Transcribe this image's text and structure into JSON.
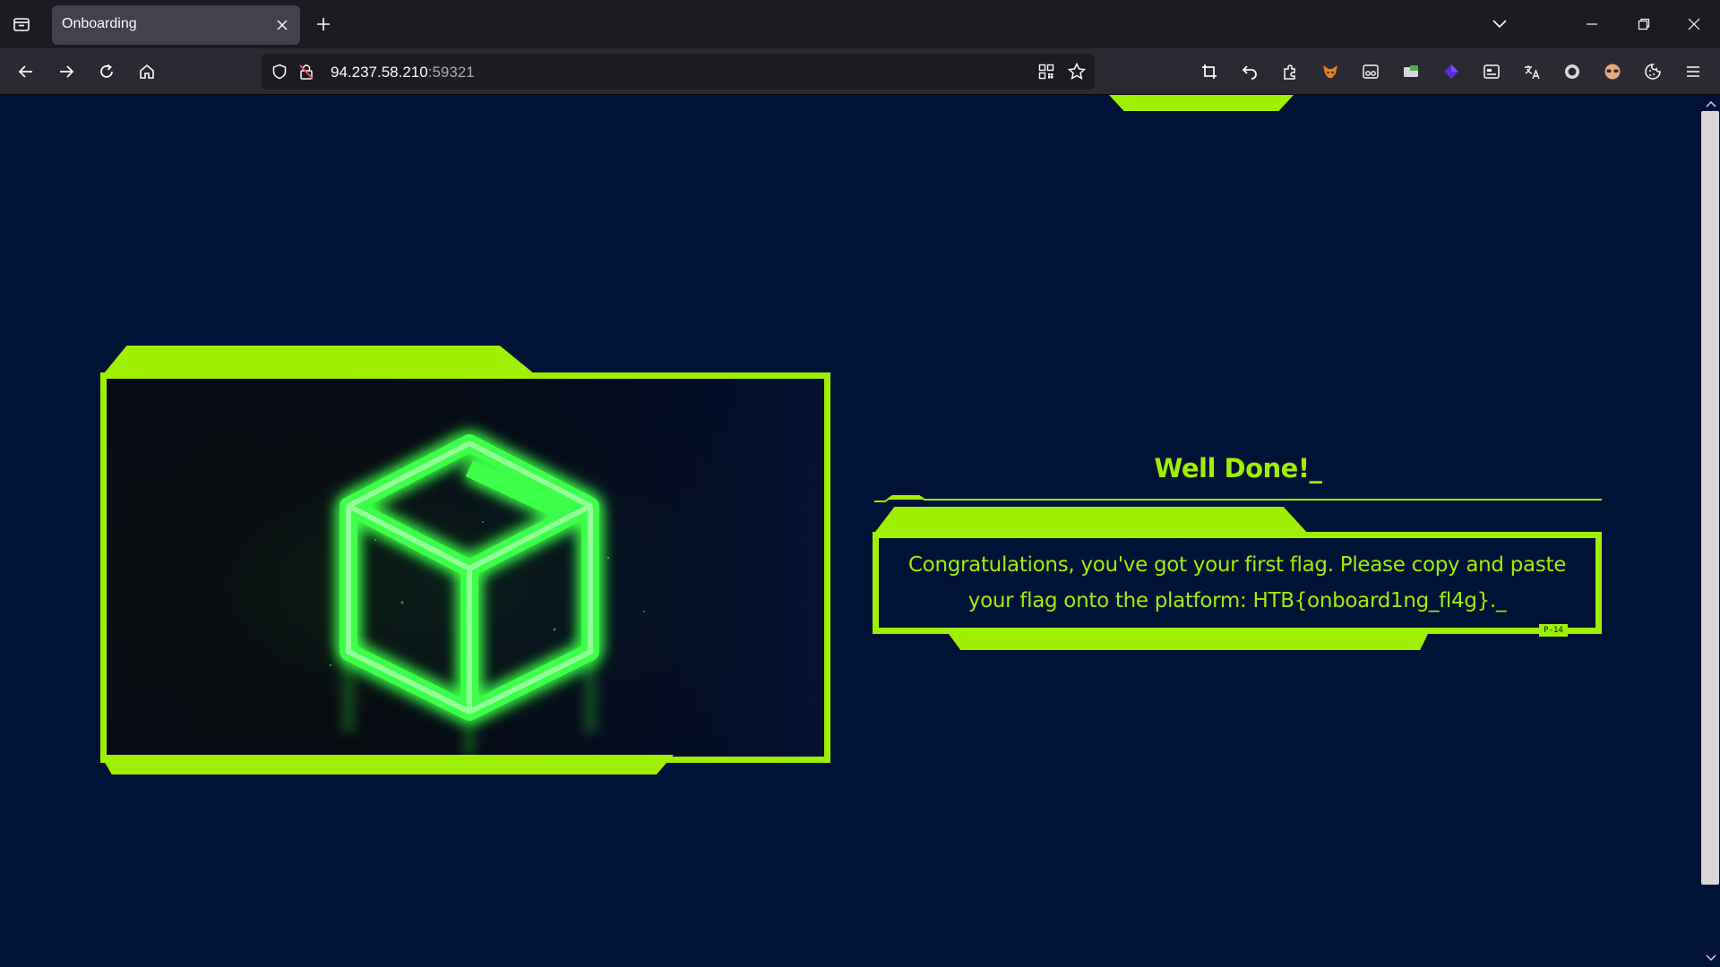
{
  "browser": {
    "tab": {
      "title": "Onboarding"
    },
    "url": {
      "host": "94.237.58.210",
      "port": ":59321"
    }
  },
  "page": {
    "heading": "Well Done!_",
    "message": "Congratulations, you've got your first flag. Please copy and paste your flag onto the platform: HTB{onboard1ng_fl4g}._",
    "code_label": "P-14"
  },
  "colors": {
    "accent": "#9fef00",
    "background": "#001336",
    "cube_glow": "#35ff3a"
  }
}
